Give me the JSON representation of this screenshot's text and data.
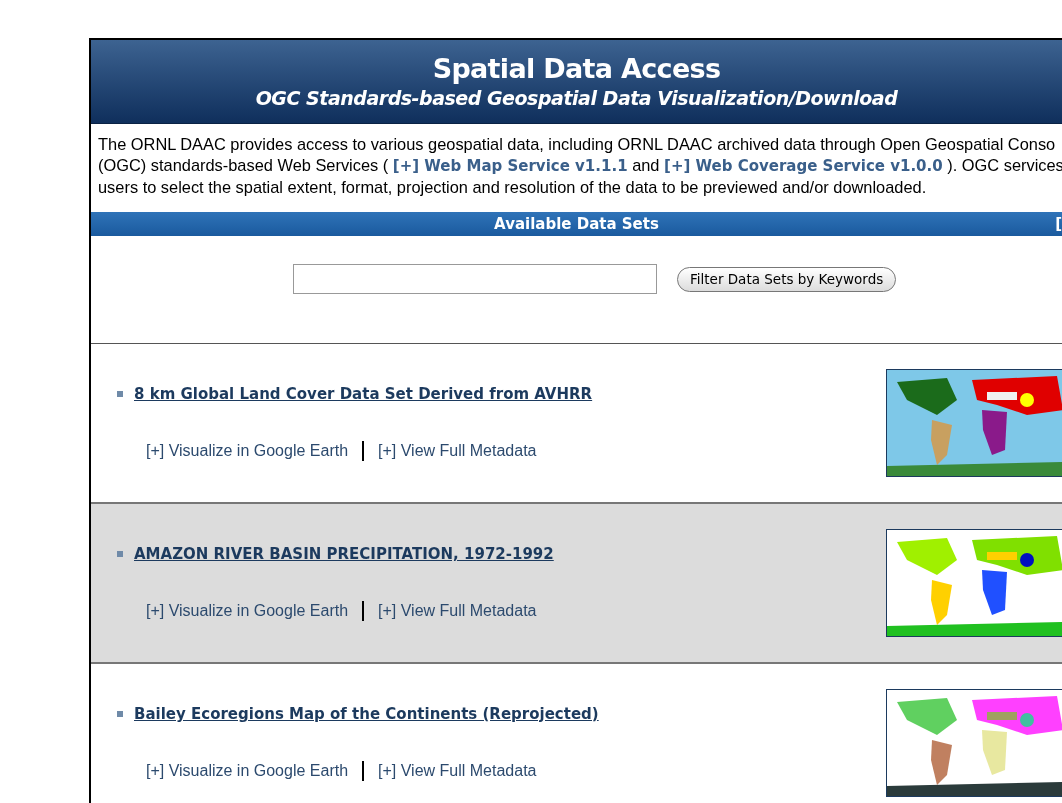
{
  "header": {
    "title": "Spatial Data Access",
    "subtitle": "OGC Standards-based Geospatial Data Visualization/Download"
  },
  "intro": [
    [
      {
        "kind": "text",
        "text": "The ORNL DAAC provides access to various geospatial data, including ORNL DAAC archived data through Open Geospatial Conso"
      }
    ],
    [
      {
        "kind": "text",
        "text": "(OGC) standards-based Web Services ( "
      },
      {
        "kind": "link",
        "text": "[+] Web Map Service v1.1.1"
      },
      {
        "kind": "text",
        "text": " and "
      },
      {
        "kind": "link",
        "text": "[+] Web Coverage Service v1.0.0"
      },
      {
        "kind": "text",
        "text": " ). OGC services"
      }
    ],
    [
      {
        "kind": "text",
        "text": "users to select the spatial extent, format, projection and resolution of the data to be previewed and/or downloaded."
      }
    ]
  ],
  "section_bar": {
    "title": "Available Data Sets",
    "right_text": "["
  },
  "search": {
    "button": "Filter Data Sets by Keywords"
  },
  "datasets": [
    {
      "title": "8 km Global Land Cover Data Set Derived from AVHRR",
      "highlighted": false,
      "links": [
        "[+] Visualize in Google Earth",
        "[+] View Full Metadata"
      ]
    },
    {
      "title": "AMAZON RIVER BASIN PRECIPITATION, 1972-1992",
      "highlighted": true,
      "links": [
        "[+] Visualize in Google Earth",
        "[+] View Full Metadata"
      ]
    },
    {
      "title": "Bailey Ecoregions Map of the Continents (Reprojected)",
      "highlighted": false,
      "links": [
        "[+] Visualize in Google Earth",
        "[+] View Full Metadata"
      ]
    }
  ]
}
